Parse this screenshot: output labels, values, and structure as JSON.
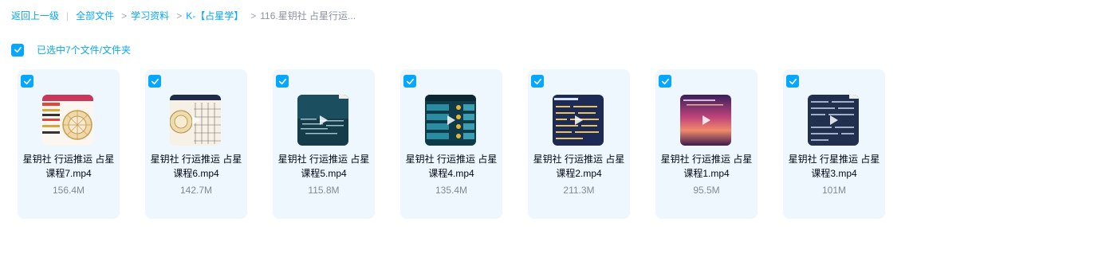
{
  "breadcrumb": {
    "back": "返回上一级",
    "all_files": "全部文件",
    "study": "学习资料",
    "astro": "K-【占星学】",
    "current": "116.星钥社 占星行运..."
  },
  "selection": {
    "label": "已选中7个文件/文件夹"
  },
  "files": [
    {
      "name": "星钥社 行运推运 占星课程7.mp4",
      "size": "156.4M"
    },
    {
      "name": "星钥社 行运推运 占星课程6.mp4",
      "size": "142.7M"
    },
    {
      "name": "星钥社 行运推运 占星课程5.mp4",
      "size": "115.8M"
    },
    {
      "name": "星钥社 行运推运 占星课程4.mp4",
      "size": "135.4M"
    },
    {
      "name": "星钥社 行运推运 占星课程2.mp4",
      "size": "211.3M"
    },
    {
      "name": "星钥社 行运推运 占星课程1.mp4",
      "size": "95.5M"
    },
    {
      "name": "星钥社 行星推运 占星课程3.mp4",
      "size": "101M"
    }
  ],
  "colors": {
    "accent": "#06a7ff",
    "card_bg": "#eef7fe",
    "size_text": "#818999"
  },
  "icons": {
    "checkbox": "check-icon",
    "play": "play-icon"
  }
}
